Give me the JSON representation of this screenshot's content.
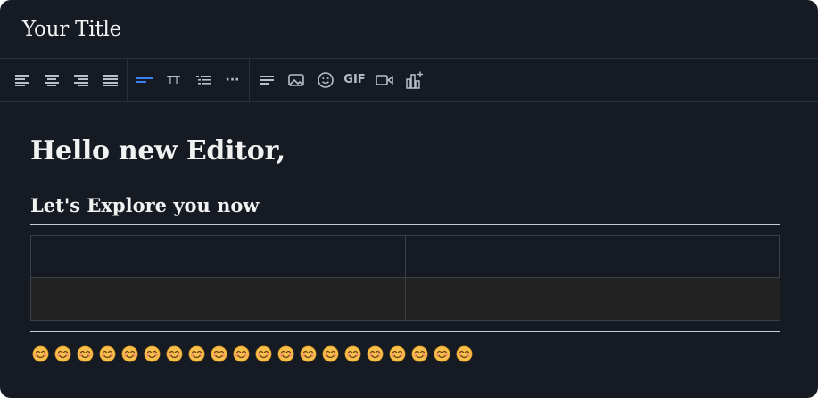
{
  "document": {
    "title": "Your Title"
  },
  "toolbar": {
    "groups": [
      [
        "align-left-icon",
        "align-center-icon",
        "align-right-icon",
        "align-justify-icon"
      ],
      [
        "paragraph-style-icon",
        "font-size-icon",
        "list-icon",
        "more-icon"
      ],
      [
        "text-block-icon",
        "image-icon",
        "emoji-icon",
        "gif-icon",
        "video-icon",
        "chart-icon"
      ]
    ],
    "font_size_label": "TT",
    "gif_label": "GIF",
    "more_label": "···",
    "active": "paragraph-style-icon",
    "accent_color": "#3b82f6"
  },
  "editor": {
    "heading1": "Hello new Editor,",
    "heading2": "Let's Explore you now",
    "table": {
      "rows": 2,
      "columns": 2,
      "cells": [
        [
          "",
          ""
        ],
        [
          "",
          ""
        ]
      ]
    },
    "emoji_count": 20
  },
  "colors": {
    "background": "#161b23",
    "text": "#f2f2f2",
    "muted_icon": "#b9bec7"
  }
}
